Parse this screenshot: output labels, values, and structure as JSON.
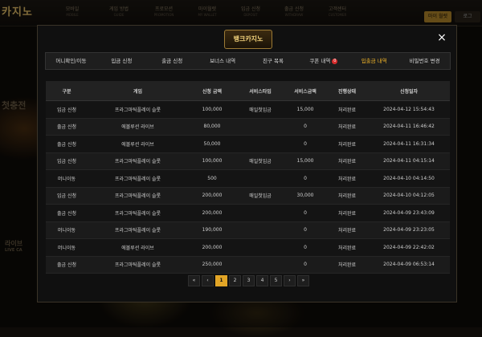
{
  "background": {
    "logo": "카지노",
    "nav": [
      {
        "label": "모바일",
        "sub": "MOBILE"
      },
      {
        "label": "게임 방법",
        "sub": "GUIDE"
      },
      {
        "label": "프로모션",
        "sub": "PROMOTION"
      },
      {
        "label": "마이월렛",
        "sub": "MY WALLET"
      },
      {
        "label": "입금 신청",
        "sub": "DEPOSIT"
      },
      {
        "label": "출금 신청",
        "sub": "WITHDRAW"
      },
      {
        "label": "고객센터",
        "sub": "CUSTOMER"
      }
    ],
    "login_label": "마이 월렛",
    "logout_label": "로그",
    "side_text": "첫충전",
    "live_label": "라이브",
    "live_sub": "LIVE CA"
  },
  "modal": {
    "logo": "뱅크카지노",
    "close_icon": "×",
    "tabs": [
      {
        "label": "머니확인/이동"
      },
      {
        "label": "입금 신청"
      },
      {
        "label": "출금 신청"
      },
      {
        "label": "보너스 내역"
      },
      {
        "label": "친구 목록"
      },
      {
        "label": "쿠폰 내역",
        "badge": "0"
      },
      {
        "label": "입출금 내역",
        "active": true
      },
      {
        "label": "비밀번호 변경"
      }
    ],
    "table": {
      "headers": [
        "구분",
        "게임",
        "신청 금액",
        "서비스타입",
        "서비스금액",
        "진행상태",
        "신청일자"
      ],
      "rows": [
        [
          "입금 신청",
          "프라그마틱플레이 슬롯",
          "100,000",
          "매일첫입금",
          "15,000",
          "처리완료",
          "2024-04-12 15:54:43"
        ],
        [
          "출금 신청",
          "에볼루션 라이브",
          "80,000",
          "",
          "0",
          "처리완료",
          "2024-04-11 16:46:42"
        ],
        [
          "출금 신청",
          "에볼루션 라이브",
          "50,000",
          "",
          "0",
          "처리완료",
          "2024-04-11 16:31:34"
        ],
        [
          "입금 신청",
          "프라그마틱플레이 슬롯",
          "100,000",
          "매일첫입금",
          "15,000",
          "처리완료",
          "2024-04-11 04:15:14"
        ],
        [
          "머니이동",
          "프라그마틱플레이 슬롯",
          "500",
          "",
          "0",
          "처리완료",
          "2024-04-10 04:14:50"
        ],
        [
          "입금 신청",
          "프라그마틱플레이 슬롯",
          "200,000",
          "매일첫입금",
          "30,000",
          "처리완료",
          "2024-04-10 04:12:05"
        ],
        [
          "출금 신청",
          "프라그마틱플레이 슬롯",
          "200,000",
          "",
          "0",
          "처리완료",
          "2024-04-09 23:43:09"
        ],
        [
          "머니이동",
          "프라그마틱플레이 슬롯",
          "190,000",
          "",
          "0",
          "처리완료",
          "2024-04-09 23:23:05"
        ],
        [
          "머니이동",
          "에볼루션 라이브",
          "200,000",
          "",
          "0",
          "처리완료",
          "2024-04-09 22:42:02"
        ],
        [
          "출금 신청",
          "프라그마틱플레이 슬롯",
          "250,000",
          "",
          "0",
          "처리완료",
          "2024-04-09 06:53:14"
        ]
      ]
    },
    "pagination": {
      "first": "«",
      "prev": "‹",
      "pages": [
        "1",
        "2",
        "3",
        "4",
        "5"
      ],
      "active": "1",
      "next": "›",
      "last": "»"
    }
  },
  "colors": {
    "accent": "#f0b429",
    "active_page": "#e2a526",
    "badge": "#d62b2b"
  }
}
